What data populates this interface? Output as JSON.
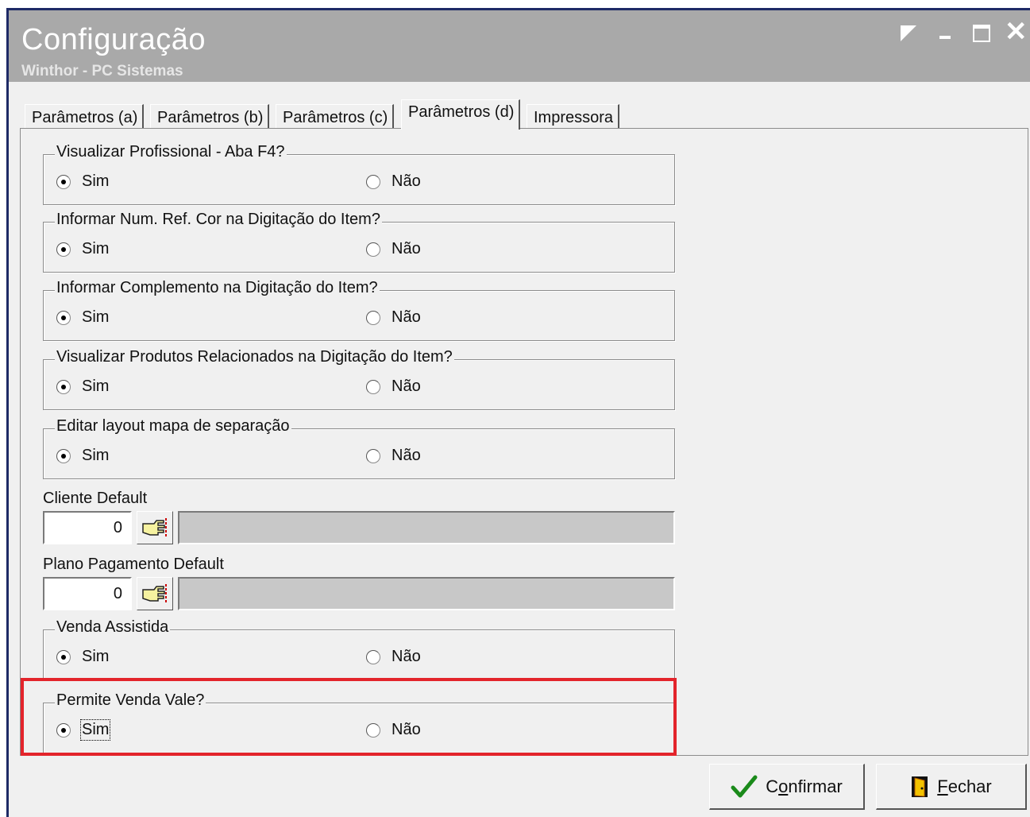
{
  "window": {
    "title": "Configuração",
    "subtitle": "Winthor - PC Sistemas"
  },
  "tabs": [
    {
      "label": "Parâmetros (a)"
    },
    {
      "label": "Parâmetros (b)"
    },
    {
      "label": "Parâmetros (c)"
    },
    {
      "label": "Parâmetros (d)",
      "active": true
    },
    {
      "label": "Impressora"
    }
  ],
  "groups": [
    {
      "title": "Visualizar Profissional - Aba F4?",
      "sim": "Sim",
      "nao": "Não",
      "selected": "Sim"
    },
    {
      "title": "Informar Num. Ref. Cor na Digitação do Item?",
      "sim": "Sim",
      "nao": "Não",
      "selected": "Sim"
    },
    {
      "title": "Informar Complemento na Digitação do Item?",
      "sim": "Sim",
      "nao": "Não",
      "selected": "Sim"
    },
    {
      "title": "Visualizar Produtos Relacionados na Digitação do Item?",
      "sim": "Sim",
      "nao": "Não",
      "selected": "Sim"
    },
    {
      "title": "Editar layout mapa de separação",
      "sim": "Sim",
      "nao": "Não",
      "selected": "Sim"
    },
    {
      "title": "Venda Assistida",
      "sim": "Sim",
      "nao": "Não",
      "selected": "Sim"
    },
    {
      "title": "Permite Venda Vale?",
      "sim": "Sim",
      "nao": "Não",
      "selected": "Sim"
    }
  ],
  "cliente_default": {
    "label": "Cliente Default",
    "value": "0",
    "description": ""
  },
  "plano_pagamento_default": {
    "label": "Plano Pagamento Default",
    "value": "0",
    "description": ""
  },
  "buttons": {
    "confirm_prefix": "C",
    "confirm_mnemonic": "o",
    "confirm_suffix": "nfirmar",
    "close_mnemonic": "F",
    "close_suffix": "echar"
  },
  "colors": {
    "titlebar": "#a9a9a9",
    "highlight": "#e3242b",
    "confirm_check": "#1a8a1a"
  },
  "icons": {
    "lookup": "pointing-hand-icon",
    "confirm": "checkmark-icon",
    "close": "exit-door-icon"
  }
}
